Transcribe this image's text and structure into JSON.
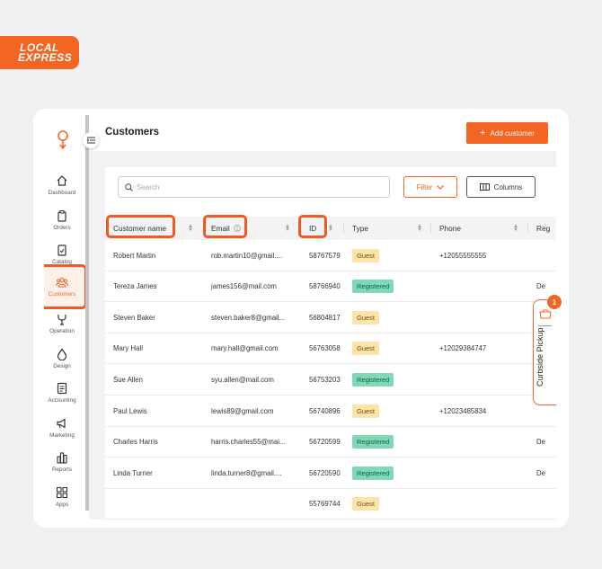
{
  "brand": {
    "line1": "LOCAL",
    "line2": "EXPRESS"
  },
  "colors": {
    "accent": "#f26522",
    "guest_badge": "#fde3a7",
    "registered_badge": "#7fd9b6"
  },
  "sidebar": {
    "items": [
      {
        "label": "Dashboard",
        "icon": "home-icon"
      },
      {
        "label": "Orders",
        "icon": "clipboard-icon"
      },
      {
        "label": "Catalog",
        "icon": "catalog-icon"
      },
      {
        "label": "Customers",
        "icon": "users-icon",
        "active": true
      },
      {
        "label": "Operation",
        "icon": "wrench-icon"
      },
      {
        "label": "Design",
        "icon": "drop-icon"
      },
      {
        "label": "Accounting",
        "icon": "ledger-icon"
      },
      {
        "label": "Marketing",
        "icon": "megaphone-icon"
      },
      {
        "label": "Reports",
        "icon": "bar-chart-icon"
      },
      {
        "label": "Apps",
        "icon": "grid-icon"
      }
    ]
  },
  "header": {
    "title": "Customers",
    "add_button": "Add customer"
  },
  "toolbar": {
    "search_placeholder": "Search",
    "filter_label": "Filter",
    "columns_label": "Columns"
  },
  "table": {
    "columns": [
      "Customer name",
      "Email",
      "ID",
      "Type",
      "Phone",
      "Reg"
    ],
    "rows": [
      {
        "name": "Robert Martin",
        "email": "rob.martin10@gmail....",
        "id": "58767579",
        "type": "Guest",
        "phone": "+12055555555",
        "reg": ""
      },
      {
        "name": "Tereza James",
        "email": "james156@mail.com",
        "id": "58766940",
        "type": "Registered",
        "phone": "",
        "reg": "De"
      },
      {
        "name": "Steven Baker",
        "email": "steven.baker8@gmail...",
        "id": "56804817",
        "type": "Guest",
        "phone": "",
        "reg": ""
      },
      {
        "name": "Mary Hall",
        "email": "mary.hall@gmail.com",
        "id": "56763058",
        "type": "Guest",
        "phone": "+12029384747",
        "reg": ""
      },
      {
        "name": "Sue Allen",
        "email": "syu.allen@mail.com",
        "id": "56753203",
        "type": "Registered",
        "phone": "",
        "reg": ""
      },
      {
        "name": "Paul Lewis",
        "email": "lewis89@gmail.com",
        "id": "56740896",
        "type": "Guest",
        "phone": "+12023485834",
        "reg": ""
      },
      {
        "name": "Charles Harris",
        "email": "harris.charles55@mai...",
        "id": "56720599",
        "type": "Registered",
        "phone": "",
        "reg": "De"
      },
      {
        "name": "Linda Turner",
        "email": "linda.turner8@gmail....",
        "id": "56720590",
        "type": "Registered",
        "phone": "",
        "reg": "De"
      },
      {
        "name": "",
        "email": "",
        "id": "55769744",
        "type": "Guest",
        "phone": "",
        "reg": ""
      }
    ]
  },
  "curbside": {
    "label": "Curbside Pickup",
    "count": "1"
  }
}
